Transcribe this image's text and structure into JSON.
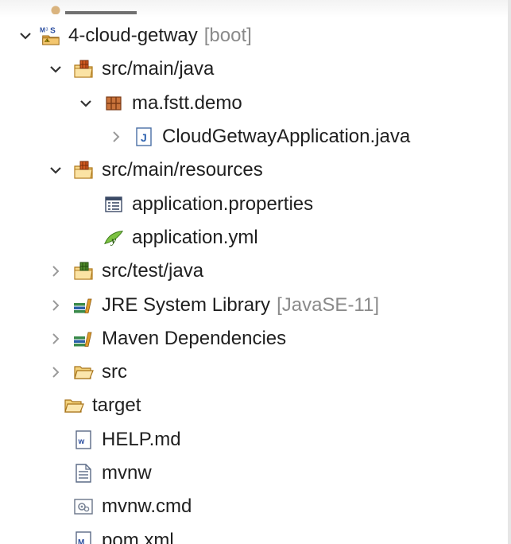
{
  "tree": {
    "items": [
      {
        "label": "4-cloud-getway",
        "decoration": "[boot]",
        "state": "expanded",
        "icon": "maven-spring-project-icon"
      },
      {
        "label": "src/main/java",
        "state": "expanded",
        "icon": "source-folder-icon"
      },
      {
        "label": "ma.fstt.demo",
        "state": "expanded",
        "icon": "package-icon"
      },
      {
        "label": "CloudGetwayApplication.java",
        "state": "collapsed",
        "icon": "java-file-icon"
      },
      {
        "label": "src/main/resources",
        "state": "expanded",
        "icon": "source-folder-icon"
      },
      {
        "label": "application.properties",
        "state": "leaf",
        "icon": "properties-file-icon"
      },
      {
        "label": "application.yml",
        "state": "leaf",
        "icon": "yaml-file-icon"
      },
      {
        "label": "src/test/java",
        "state": "collapsed",
        "icon": "test-source-folder-icon"
      },
      {
        "label": "JRE System Library",
        "decoration": "[JavaSE-11]",
        "state": "collapsed",
        "icon": "library-icon"
      },
      {
        "label": "Maven Dependencies",
        "state": "collapsed",
        "icon": "library-icon"
      },
      {
        "label": "src",
        "state": "collapsed",
        "icon": "folder-icon"
      },
      {
        "label": "target",
        "state": "leaf",
        "icon": "folder-icon"
      },
      {
        "label": "HELP.md",
        "state": "leaf",
        "icon": "markdown-file-icon"
      },
      {
        "label": "mvnw",
        "state": "leaf",
        "icon": "text-file-icon"
      },
      {
        "label": "mvnw.cmd",
        "state": "leaf",
        "icon": "cmd-file-icon"
      },
      {
        "label": "pom.xml",
        "state": "leaf",
        "icon": "maven-pom-icon"
      }
    ]
  }
}
